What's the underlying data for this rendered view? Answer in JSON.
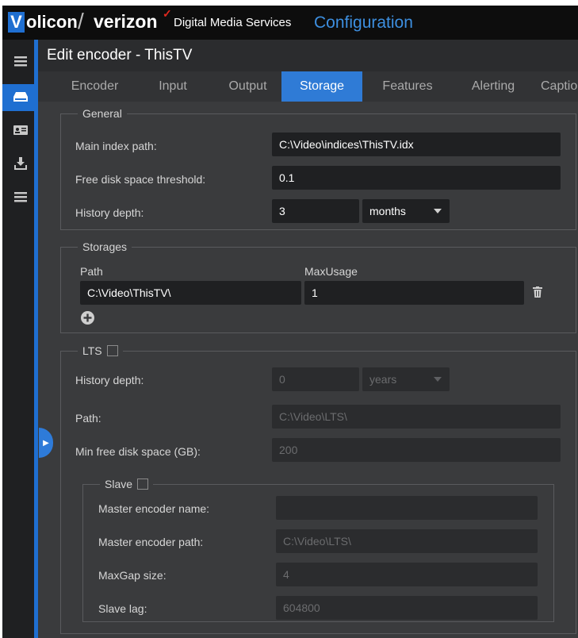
{
  "brand": {
    "volicon_first": "V",
    "volicon_rest": "olicon",
    "separator": "/",
    "verizon": "verizon",
    "checkmark": "✓",
    "product": "Digital Media Services",
    "section": "Configuration"
  },
  "sidebar": {
    "items": [
      {
        "icon": "hamburger-menu-icon"
      },
      {
        "icon": "drive-icon",
        "active": true
      },
      {
        "icon": "id-card-icon"
      },
      {
        "icon": "download-icon"
      },
      {
        "icon": "list-icon"
      }
    ],
    "toggle_icon": "chevron-right-icon"
  },
  "page_title": "Edit encoder - ThisTV",
  "tabs": [
    "Encoder",
    "Input",
    "Output",
    "Storage",
    "Features",
    "Alerting",
    "Captio"
  ],
  "active_tab": "Storage",
  "general": {
    "legend": "General",
    "main_index_label": "Main index path:",
    "main_index_value": "C:\\Video\\indices\\ThisTV.idx",
    "free_disk_label": "Free disk space threshold:",
    "free_disk_value": "0.1",
    "history_label": "History depth:",
    "history_value": "3",
    "history_unit": "months"
  },
  "storages": {
    "legend": "Storages",
    "col_path": "Path",
    "col_maxusage": "MaxUsage",
    "rows": [
      {
        "path": "C:\\Video\\ThisTV\\",
        "max_usage": "1"
      }
    ]
  },
  "lts": {
    "legend": "LTS",
    "checked": false,
    "history_label": "History depth:",
    "history_value": "0",
    "history_unit": "years",
    "path_label": "Path:",
    "path_value": "C:\\Video\\LTS\\",
    "min_free_label": "Min free disk space (GB):",
    "min_free_value": "200"
  },
  "slave": {
    "legend": "Slave",
    "checked": false,
    "master_name_label": "Master encoder name:",
    "master_name_value": "",
    "master_path_label": "Master encoder path:",
    "master_path_value": "C:\\Video\\LTS\\",
    "maxgap_label": "MaxGap size:",
    "maxgap_value": "4",
    "slave_lag_label": "Slave lag:",
    "slave_lag_value": "604800"
  },
  "colors": {
    "accent": "#1f6fd1",
    "tab_active": "#2f7bd6",
    "panel_bg": "#3a3b3d",
    "field_bg": "#1f2022",
    "verizon_red": "#e0281e"
  }
}
